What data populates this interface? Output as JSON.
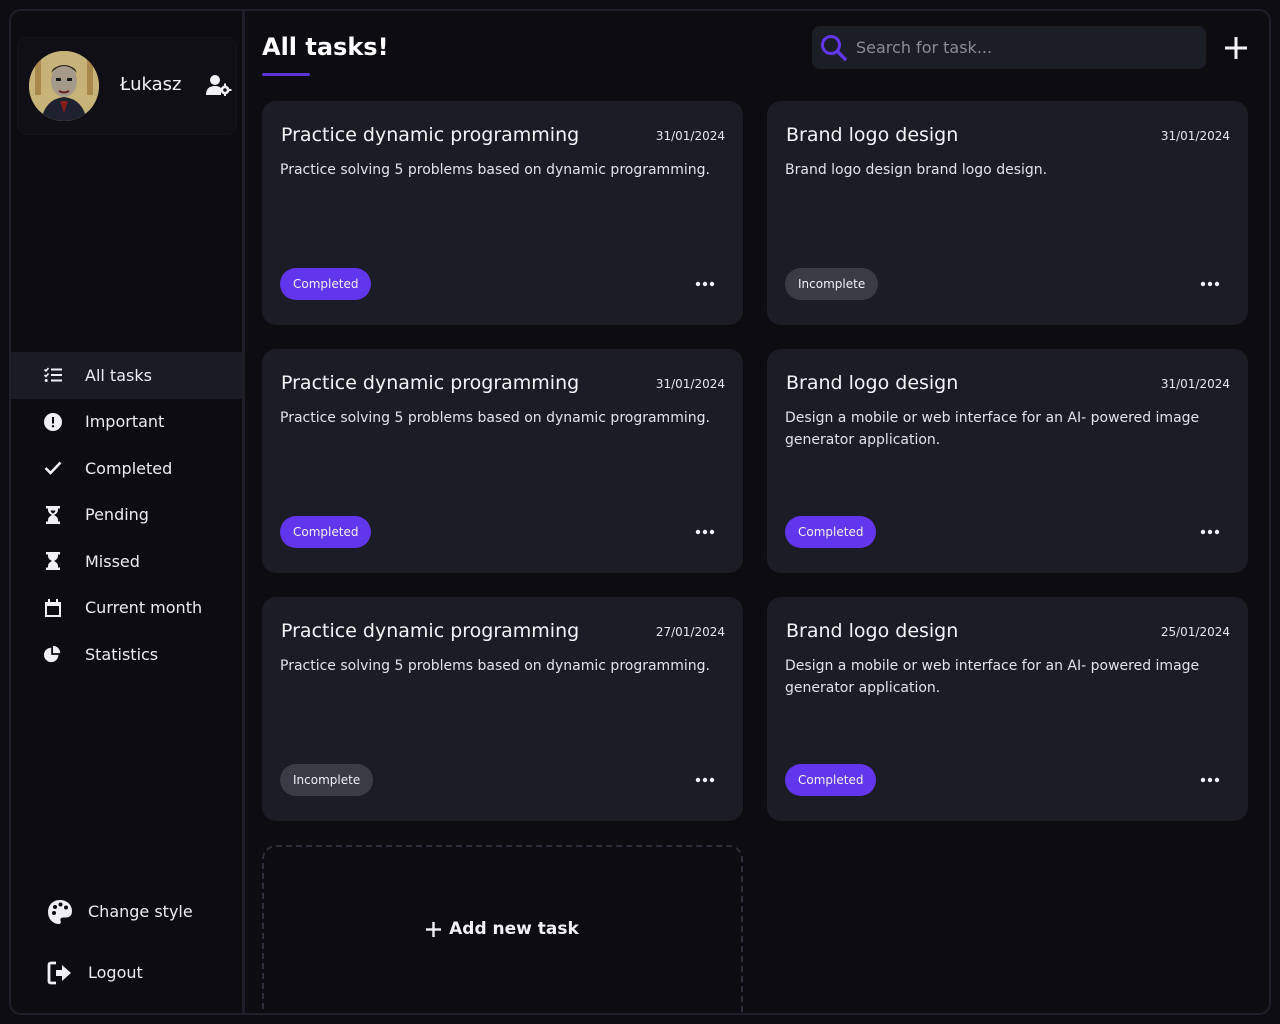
{
  "profile": {
    "name": "Łukasz"
  },
  "nav": {
    "items": [
      {
        "label": "All tasks",
        "icon": "list-check-icon",
        "active": true
      },
      {
        "label": "Important",
        "icon": "exclamation-circle-icon"
      },
      {
        "label": "Completed",
        "icon": "check-icon"
      },
      {
        "label": "Pending",
        "icon": "hourglass-icon"
      },
      {
        "label": "Missed",
        "icon": "hourglass-icon"
      },
      {
        "label": "Current month",
        "icon": "calendar-icon"
      },
      {
        "label": "Statistics",
        "icon": "pie-chart-icon"
      }
    ],
    "change_style": "Change style",
    "logout": "Logout"
  },
  "header": {
    "title": "All tasks!",
    "search_placeholder": "Search for task..."
  },
  "tasks": [
    {
      "title": "Practice dynamic programming",
      "date": "31/01/2024",
      "description": "Practice solving 5 problems based on dynamic programming.",
      "status": "Completed"
    },
    {
      "title": "Brand logo design",
      "date": "31/01/2024",
      "description": "Brand logo design brand logo design.",
      "status": "Incomplete"
    },
    {
      "title": "Practice dynamic programming",
      "date": "31/01/2024",
      "description": "Practice solving 5 problems based on dynamic programming.",
      "status": "Completed"
    },
    {
      "title": "Brand logo design",
      "date": "31/01/2024",
      "description": "Design a mobile or web interface for an AI- powered image generator application.",
      "status": "Completed"
    },
    {
      "title": "Practice dynamic programming",
      "date": "27/01/2024",
      "description": "Practice solving 5 problems based on dynamic programming.",
      "status": "Incomplete"
    },
    {
      "title": "Brand logo design",
      "date": "25/01/2024",
      "description": "Design a mobile or web interface for an AI- powered image generator application.",
      "status": "Completed"
    }
  ],
  "add_task_label": "Add new task",
  "colors": {
    "accent": "#6236ec",
    "incomplete": "#3a3b45",
    "card": "#1b1c26"
  }
}
